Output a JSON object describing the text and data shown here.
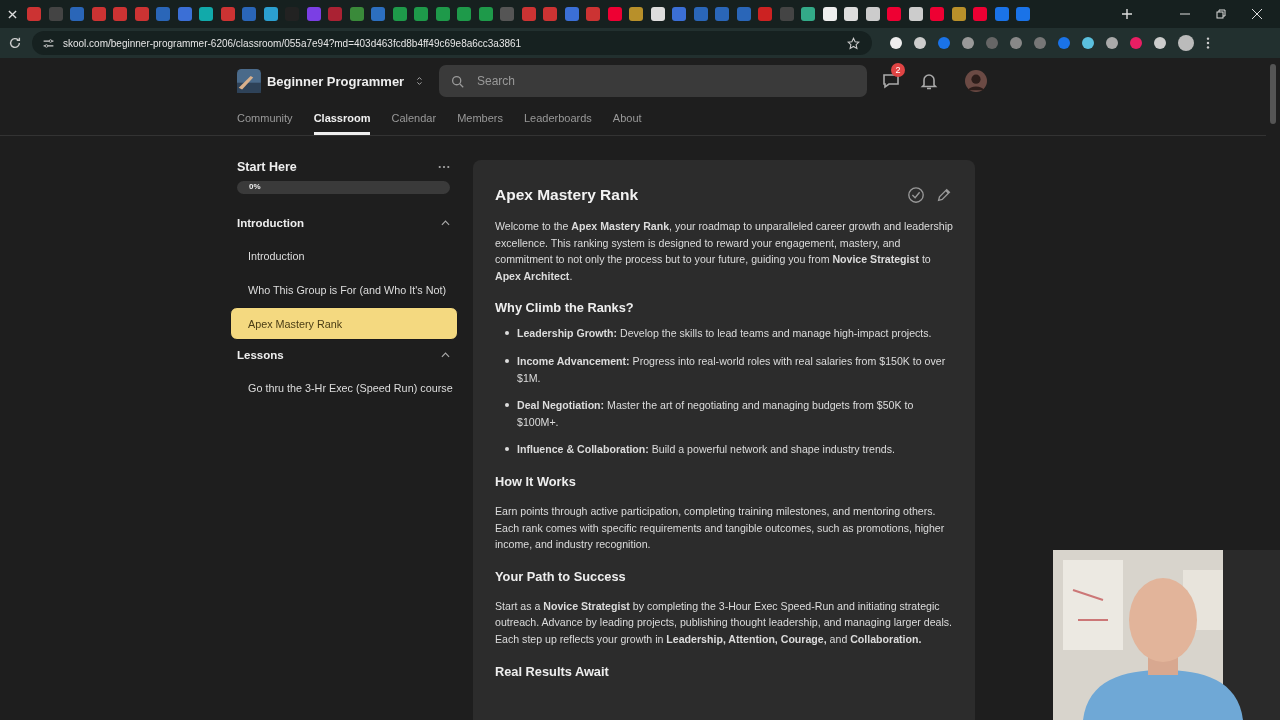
{
  "browser": {
    "url": "skool.com/beginner-programmer-6206/classroom/055a7e94?md=403d463fcd8b4ff49c69e8a6cc3a3861"
  },
  "header": {
    "group_name": "Beginner Programmer",
    "search": {
      "placeholder": "Search"
    },
    "chat_badge": "2"
  },
  "nav_tabs": [
    {
      "label": "Community",
      "selected": false
    },
    {
      "label": "Classroom",
      "selected": true
    },
    {
      "label": "Calendar",
      "selected": false
    },
    {
      "label": "Members",
      "selected": false
    },
    {
      "label": "Leaderboards",
      "selected": false
    },
    {
      "label": "About",
      "selected": false
    }
  ],
  "sidebar": {
    "course_title": "Start Here",
    "progress": {
      "level": 0,
      "reading": "0%"
    },
    "sections": [
      {
        "title": "Introduction",
        "expanded": true,
        "items": [
          {
            "label": "Introduction",
            "selected": false
          },
          {
            "label": "Who This Group is For (and Who It's Not)",
            "selected": false
          },
          {
            "label": "Apex Mastery Rank",
            "selected": true
          }
        ]
      },
      {
        "title": "Lessons",
        "expanded": true,
        "items": [
          {
            "label": "Go thru the 3-Hr Exec (Speed Run) course",
            "selected": false
          }
        ]
      }
    ]
  },
  "lesson": {
    "title": "Apex Mastery Rank",
    "completed": false,
    "blocks": [
      {
        "kind": "paragraph",
        "text": "Welcome to the **Apex Mastery Rank**, your roadmap to unparalleled career growth and leadership excellence. This ranking system is designed to reward your engagement, mastery, and commitment to not only the process but to your future, guiding you from **Novice Strategist** to **Apex Architect**."
      },
      {
        "kind": "heading",
        "text": "Why Climb the Ranks?"
      },
      {
        "kind": "list",
        "items": [
          "**Leadership Growth:** Develop the skills to lead teams and manage high-impact projects.",
          "**Income Advancement:** Progress into real-world roles with real salaries from $150K to over $1M.",
          "**Deal Negotiation:** Master the art of negotiating and managing budgets from $50K to $100M+.",
          "**Influence & Collaboration:** Build a powerful network and shape industry trends."
        ]
      },
      {
        "kind": "heading",
        "text": "How It Works"
      },
      {
        "kind": "paragraph",
        "text": "Earn points through active participation, completing training milestones, and mentoring others. Each rank comes with specific requirements and tangible outcomes, such as promotions, higher income, and industry recognition."
      },
      {
        "kind": "heading",
        "text": "Your Path to Success"
      },
      {
        "kind": "paragraph",
        "text": "Start as a **Novice Strategist** by completing the 3-Hour Exec Speed-Run and initiating strategic outreach. Advance by leading projects, publishing thought leadership, and managing larger deals. Each step up reflects your growth in **Leadership, Attention, Courage,** and **Collaboration.**"
      },
      {
        "kind": "heading",
        "text": "Real Results Await"
      }
    ]
  }
}
